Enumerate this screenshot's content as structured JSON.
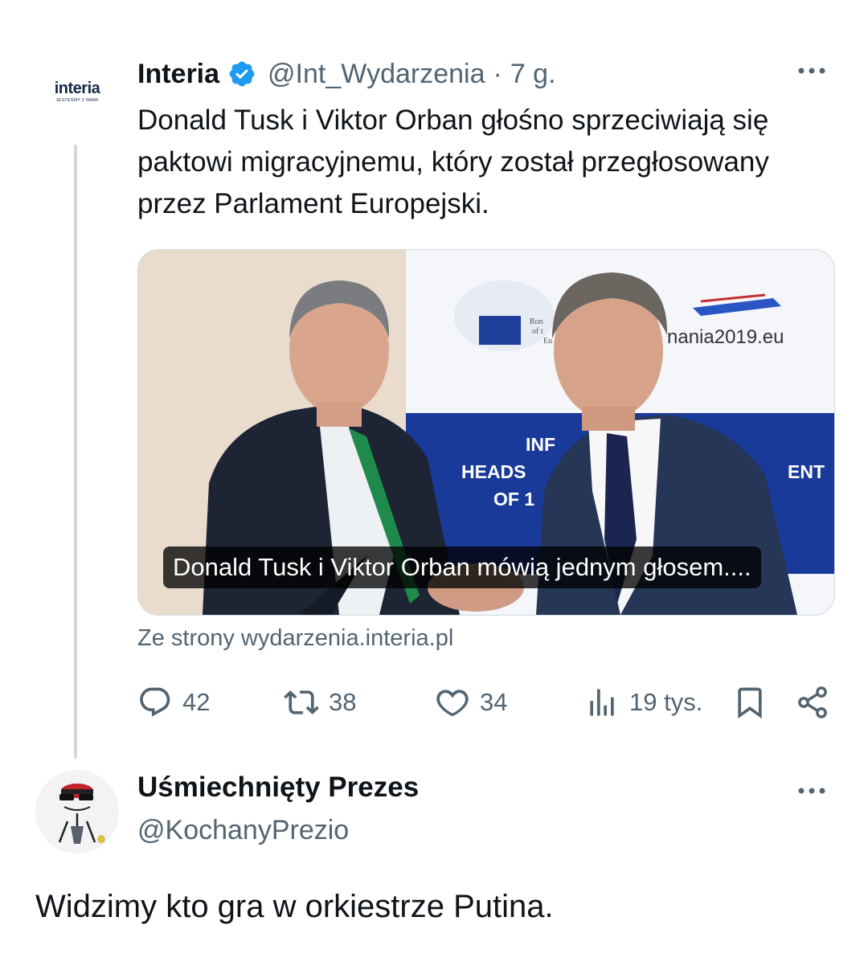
{
  "tweet": {
    "avatar_logo": "interia",
    "avatar_tagline": "JESTEŚMY Z WAMI",
    "name": "Interia",
    "handle": "@Int_Wydarzenia",
    "separator": "·",
    "time": "7 g.",
    "more_icon": "more-horizontal-icon",
    "text": "Donald Tusk i Viktor Orban głośno sprzeciwiają się paktowi migracyjnemu, który został przegłosowany przez Parlament Europejski.",
    "card": {
      "caption": "Donald Tusk i Viktor Orban mówią jednym głosem....",
      "source": "Ze strony wydarzenia.interia.pl",
      "backdrop_text_domain": "nania2019.eu",
      "backdrop_text_1": "INF",
      "backdrop_text_2": "HEADS",
      "backdrop_text_3": "OF 1",
      "backdrop_text_4": "ENT",
      "backdrop_small_1": "Ron",
      "backdrop_small_2": "of t",
      "backdrop_small_3": "Eu"
    },
    "actions": {
      "replies": "42",
      "retweets": "38",
      "likes": "34",
      "views": "19 tys."
    }
  },
  "reply": {
    "name": "Uśmiechnięty Prezes",
    "handle": "@KochanyPrezio",
    "text": "Widzimy kto gra w orkiestrze Putina."
  },
  "colors": {
    "verified": "#1d9bf0",
    "secondary_text": "#536471",
    "thread_line": "#cfd9de"
  }
}
